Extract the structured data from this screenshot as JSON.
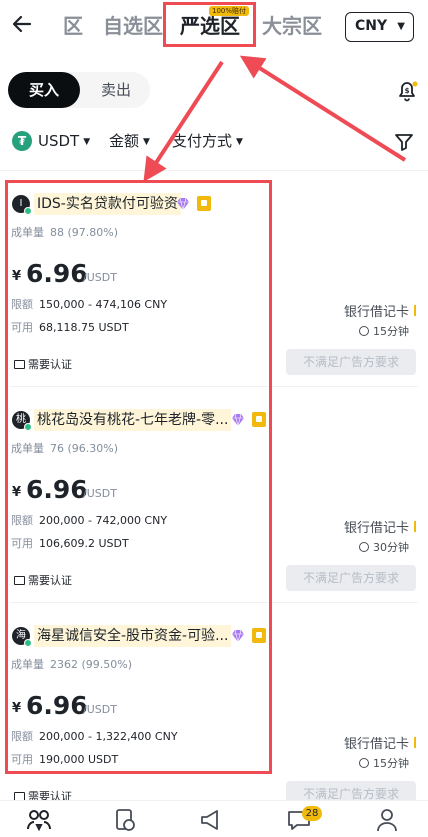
{
  "header": {
    "partial_tab": "区",
    "tabs": [
      {
        "label": "自选区"
      },
      {
        "label": "严选区",
        "badge": "100%赔付"
      },
      {
        "label": "大宗区"
      }
    ],
    "currency": "CNY"
  },
  "trade_toggle": {
    "buy": "买入",
    "sell": "卖出"
  },
  "filters": {
    "asset": "USDT",
    "amount": "金额",
    "payment": "支付方式"
  },
  "ads": [
    {
      "avatar": "I",
      "merchant": "IDS-实名贷款付可验资",
      "orders_label": "成单量",
      "orders": "88 (97.80%)",
      "currency_symbol": "¥",
      "price": "6.96",
      "price_unit": "/USDT",
      "limit_label": "限额",
      "limit": "150,000 - 474,106 CNY",
      "avail_label": "可用",
      "available": "68,118.75 USDT",
      "kyc": "需要认证",
      "payment": "银行借记卡",
      "time": "15分钟",
      "status": "不满足广告方要求"
    },
    {
      "avatar": "桃",
      "merchant": "桃花岛没有桃花-七年老牌-零...",
      "orders_label": "成单量",
      "orders": "76 (96.30%)",
      "currency_symbol": "¥",
      "price": "6.96",
      "price_unit": "/USDT",
      "limit_label": "限额",
      "limit": "200,000 - 742,000 CNY",
      "avail_label": "可用",
      "available": "106,609.2 USDT",
      "kyc": "需要认证",
      "payment": "银行借记卡",
      "time": "30分钟",
      "status": "不满足广告方要求"
    },
    {
      "avatar": "海",
      "merchant": "海星诚信安全-股市资金-可验...",
      "orders_label": "成单量",
      "orders": "2362 (99.50%)",
      "currency_symbol": "¥",
      "price": "6.96",
      "price_unit": "/USDT",
      "limit_label": "限额",
      "limit": "200,000 - 1,322,400 CNY",
      "avail_label": "可用",
      "available": "190,000 USDT",
      "kyc": "需要认证",
      "payment": "银行借记卡",
      "time": "15分钟",
      "status": "不满足广告方要求"
    }
  ],
  "bottom_nav": {
    "chat_badge": "28"
  },
  "colors": {
    "accent": "#f0b90b",
    "highlight": "#ee4b55",
    "online": "#2ebd85"
  }
}
